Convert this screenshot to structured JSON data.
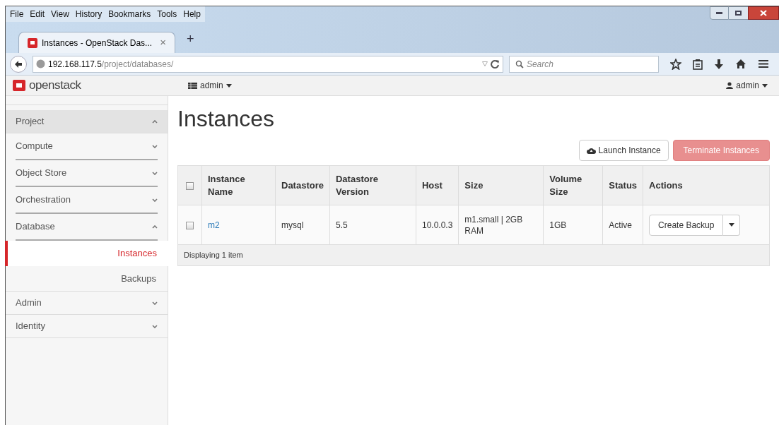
{
  "menu_bar": [
    "File",
    "Edit",
    "View",
    "History",
    "Bookmarks",
    "Tools",
    "Help"
  ],
  "tabs": [
    {
      "title": "Instances - OpenStack Das...",
      "close": "×",
      "selected": true
    }
  ],
  "new_tab": "+",
  "address": {
    "host": "192.168.117.5",
    "path": "/project/databases/"
  },
  "search": {
    "placeholder": "Search"
  },
  "header": {
    "logo": "openstack",
    "project": "admin",
    "user": "admin"
  },
  "sidebar": [
    {
      "label": "Project",
      "expanded": true,
      "children": [
        {
          "label": "Compute",
          "expanded": false
        },
        {
          "label": "Object Store",
          "expanded": false
        },
        {
          "label": "Orchestration",
          "expanded": false
        },
        {
          "label": "Database",
          "expanded": true,
          "children": [
            {
              "label": "Instances",
              "selected": true
            },
            {
              "label": "Backups",
              "selected": false
            }
          ]
        }
      ]
    },
    {
      "label": "Admin",
      "expanded": false
    },
    {
      "label": "Identity",
      "expanded": false
    }
  ],
  "page_title": "Instances",
  "buttons": [
    {
      "label": "Launch Instance",
      "kind": "default"
    },
    {
      "label": "Terminate Instances",
      "kind": "danger"
    }
  ],
  "table": {
    "select_all_checked": false,
    "columns": [
      "Instance Name",
      "Datastore",
      "Datastore Version",
      "Host",
      "Size",
      "Volume Size",
      "Status",
      "Actions"
    ],
    "rows": [
      {
        "checked": false,
        "cells": [
          "m2",
          "mysql",
          "5.5",
          "10.0.0.3",
          "m1.small | 2GB RAM",
          "1GB",
          "Active"
        ],
        "action": "Create Backup"
      }
    ],
    "footer": "Displaying 1 item"
  }
}
